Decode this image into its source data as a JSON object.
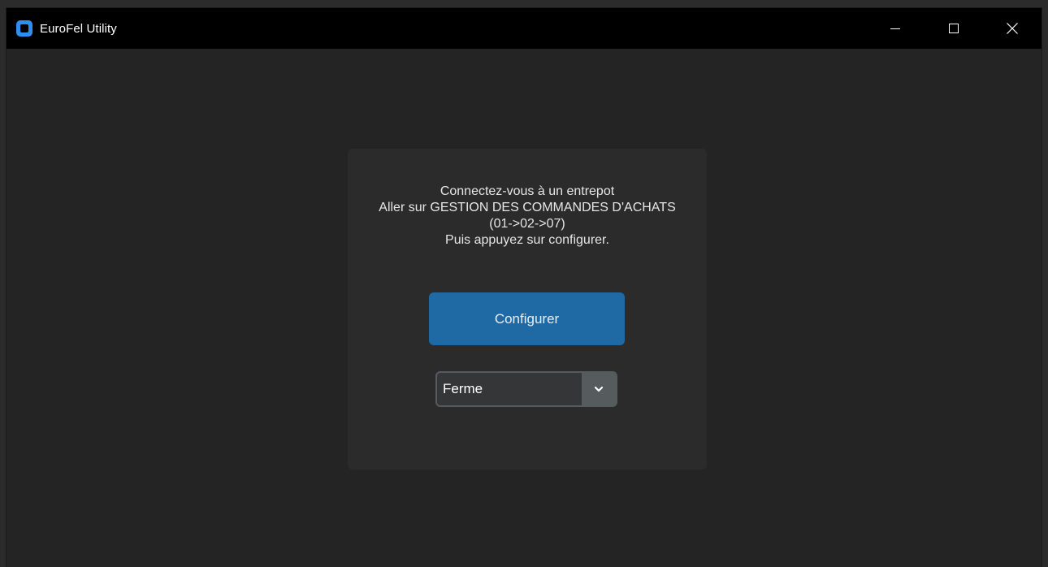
{
  "window": {
    "title": "EuroFel Utility",
    "icon": "app-icon",
    "controls": [
      "minimize-icon",
      "maximize-icon",
      "close-icon"
    ]
  },
  "panel": {
    "instructions": [
      "Connectez-vous à un entrepot",
      "Aller sur GESTION DES COMMANDES D'ACHATS",
      "(01->02->07)",
      "Puis appuyez sur configurer."
    ],
    "configure_label": "Configurer",
    "dropdown": {
      "selected": "Ferme",
      "icon": "chevron-down-icon"
    }
  },
  "colors": {
    "titlebar": "#000000",
    "background": "#242424",
    "panel": "#2b2b2b",
    "accent": "#1f6aa5",
    "combo_border": "#565b5e"
  }
}
